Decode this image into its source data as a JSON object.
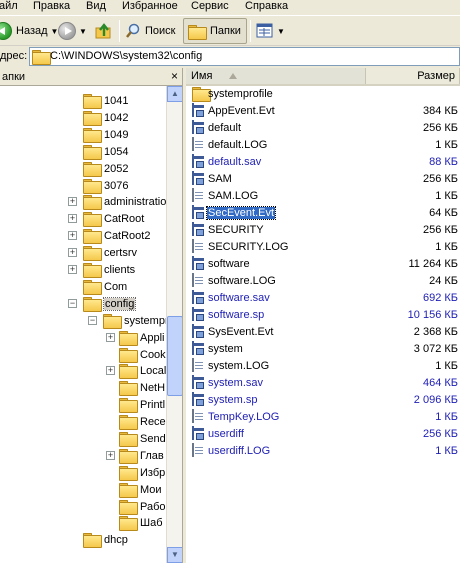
{
  "menu": [
    "айл",
    "Правка",
    "Вид",
    "Избранное",
    "Сервис",
    "Справка"
  ],
  "toolbar": {
    "back_label": "Назад",
    "search_label": "Поиск",
    "folders_label": "Папки"
  },
  "address": {
    "label": "дрес:",
    "path": "C:\\WINDOWS\\system32\\config"
  },
  "folders_panel": {
    "title": "апки",
    "close_glyph": "×",
    "items": [
      {
        "label": "1041",
        "depth": 0,
        "expander": ""
      },
      {
        "label": "1042",
        "depth": 0,
        "expander": ""
      },
      {
        "label": "1049",
        "depth": 0,
        "expander": ""
      },
      {
        "label": "1054",
        "depth": 0,
        "expander": ""
      },
      {
        "label": "2052",
        "depth": 0,
        "expander": ""
      },
      {
        "label": "3076",
        "depth": 0,
        "expander": ""
      },
      {
        "label": "administratio",
        "depth": 0,
        "expander": "+"
      },
      {
        "label": "CatRoot",
        "depth": 0,
        "expander": "+"
      },
      {
        "label": "CatRoot2",
        "depth": 0,
        "expander": "+"
      },
      {
        "label": "certsrv",
        "depth": 0,
        "expander": "+"
      },
      {
        "label": "clients",
        "depth": 0,
        "expander": "+"
      },
      {
        "label": "Com",
        "depth": 0,
        "expander": ""
      },
      {
        "label": "config",
        "depth": 0,
        "expander": "−",
        "selected": true
      },
      {
        "label": "systempr",
        "depth": 1,
        "expander": "−"
      },
      {
        "label": "Appli",
        "depth": 2,
        "expander": "+"
      },
      {
        "label": "Cook",
        "depth": 2,
        "expander": ""
      },
      {
        "label": "Local",
        "depth": 2,
        "expander": "+"
      },
      {
        "label": "NetH",
        "depth": 2,
        "expander": ""
      },
      {
        "label": "Printl",
        "depth": 2,
        "expander": ""
      },
      {
        "label": "Rece",
        "depth": 2,
        "expander": ""
      },
      {
        "label": "Send",
        "depth": 2,
        "expander": ""
      },
      {
        "label": "Глав",
        "depth": 2,
        "expander": "+"
      },
      {
        "label": "Избр",
        "depth": 2,
        "expander": ""
      },
      {
        "label": "Мои",
        "depth": 2,
        "expander": ""
      },
      {
        "label": "Рабо",
        "depth": 2,
        "expander": ""
      },
      {
        "label": "Шаб",
        "depth": 2,
        "expander": ""
      },
      {
        "label": "dhcp",
        "depth": 0,
        "expander": ""
      }
    ]
  },
  "file_list": {
    "columns": {
      "name": "Имя",
      "size": "Размер"
    },
    "rows": [
      {
        "name": "systemprofile",
        "size": "",
        "icon": "folder-icon",
        "blue": false
      },
      {
        "name": "AppEvent.Evt",
        "size": "384 КБ",
        "icon": "system-file-icon",
        "blue": false
      },
      {
        "name": "default",
        "size": "256 КБ",
        "icon": "system-file-icon",
        "blue": false
      },
      {
        "name": "default.LOG",
        "size": "1 КБ",
        "icon": "document-icon",
        "blue": false
      },
      {
        "name": "default.sav",
        "size": "88 КБ",
        "icon": "system-file-icon",
        "blue": true
      },
      {
        "name": "SAM",
        "size": "256 КБ",
        "icon": "system-file-icon",
        "blue": false
      },
      {
        "name": "SAM.LOG",
        "size": "1 КБ",
        "icon": "document-icon",
        "blue": false
      },
      {
        "name": "SecEvent.Evt",
        "size": "64 КБ",
        "icon": "system-file-icon",
        "blue": false,
        "selected": true
      },
      {
        "name": "SECURITY",
        "size": "256 КБ",
        "icon": "system-file-icon",
        "blue": false
      },
      {
        "name": "SECURITY.LOG",
        "size": "1 КБ",
        "icon": "document-icon",
        "blue": false
      },
      {
        "name": "software",
        "size": "11 264 КБ",
        "icon": "system-file-icon",
        "blue": false
      },
      {
        "name": "software.LOG",
        "size": "24 КБ",
        "icon": "document-icon",
        "blue": false
      },
      {
        "name": "software.sav",
        "size": "692 КБ",
        "icon": "system-file-icon",
        "blue": true
      },
      {
        "name": "software.sp",
        "size": "10 156 КБ",
        "icon": "system-file-icon",
        "blue": true
      },
      {
        "name": "SysEvent.Evt",
        "size": "2 368 КБ",
        "icon": "system-file-icon",
        "blue": false
      },
      {
        "name": "system",
        "size": "3 072 КБ",
        "icon": "system-file-icon",
        "blue": false
      },
      {
        "name": "system.LOG",
        "size": "1 КБ",
        "icon": "document-icon",
        "blue": false
      },
      {
        "name": "system.sav",
        "size": "464 КБ",
        "icon": "system-file-icon",
        "blue": true
      },
      {
        "name": "system.sp",
        "size": "2 096 КБ",
        "icon": "system-file-icon",
        "blue": true
      },
      {
        "name": "TempKey.LOG",
        "size": "1 КБ",
        "icon": "document-icon",
        "blue": true
      },
      {
        "name": "userdiff",
        "size": "256 КБ",
        "icon": "system-file-icon",
        "blue": true
      },
      {
        "name": "userdiff.LOG",
        "size": "1 КБ",
        "icon": "document-icon",
        "blue": true
      }
    ]
  },
  "colors": {
    "compressed_text": "#1e1eb4",
    "selection": "#316ac5"
  }
}
